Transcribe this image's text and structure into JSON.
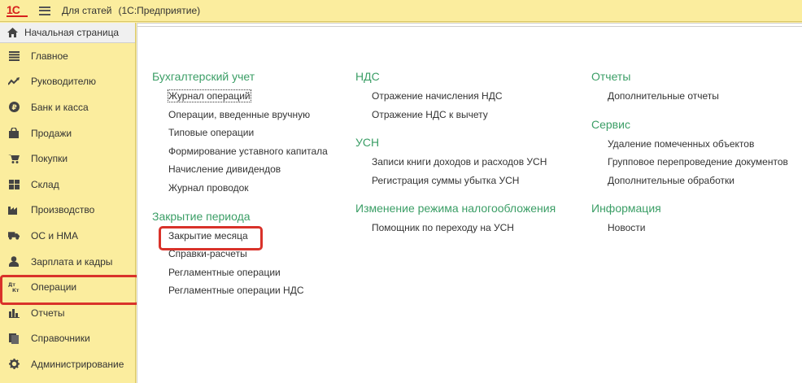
{
  "titlebar": {
    "logo_text": "1С",
    "app_name": "Для статей",
    "platform": "(1С:Предприятие)"
  },
  "sidebar": {
    "home": "Начальная страница",
    "items": [
      {
        "label": "Главное",
        "icon": "list-icon"
      },
      {
        "label": "Руководителю",
        "icon": "trend-icon"
      },
      {
        "label": "Банк и касса",
        "icon": "ruble-icon"
      },
      {
        "label": "Продажи",
        "icon": "bag-icon"
      },
      {
        "label": "Покупки",
        "icon": "cart-icon"
      },
      {
        "label": "Склад",
        "icon": "warehouse-icon"
      },
      {
        "label": "Производство",
        "icon": "factory-icon"
      },
      {
        "label": "ОС и НМА",
        "icon": "truck-icon"
      },
      {
        "label": "Зарплата и кадры",
        "icon": "person-icon"
      },
      {
        "label": "Операции",
        "icon": "dt-kt-icon"
      },
      {
        "label": "Отчеты",
        "icon": "bar-chart-icon"
      },
      {
        "label": "Справочники",
        "icon": "books-icon"
      },
      {
        "label": "Администрирование",
        "icon": "gear-icon"
      }
    ]
  },
  "content": {
    "col1": {
      "sections": [
        {
          "title": "Бухгалтерский учет",
          "links": [
            "Журнал операций",
            "Операции, введенные вручную",
            "Типовые операции",
            "Формирование уставного капитала",
            "Начисление дивидендов",
            "Журнал проводок"
          ]
        },
        {
          "title": "Закрытие периода",
          "links": [
            "Закрытие месяца",
            "Справки-расчеты",
            "Регламентные операции",
            "Регламентные операции НДС"
          ]
        }
      ]
    },
    "col2": {
      "sections": [
        {
          "title": "НДС",
          "links": [
            "Отражение начисления НДС",
            "Отражение НДС к вычету"
          ]
        },
        {
          "title": "УСН",
          "links": [
            "Записи книги доходов и расходов УСН",
            "Регистрация суммы убытка УСН"
          ]
        },
        {
          "title": "Изменение режима налогообложения",
          "links": [
            "Помощник по переходу на УСН"
          ]
        }
      ]
    },
    "col3": {
      "sections": [
        {
          "title": "Отчеты",
          "links": [
            "Дополнительные отчеты"
          ]
        },
        {
          "title": "Сервис",
          "links": [
            "Удаление помеченных объектов",
            "Групповое перепроведение документов",
            "Дополнительные обработки"
          ]
        },
        {
          "title": "Информация",
          "links": [
            "Новости"
          ]
        }
      ]
    }
  }
}
